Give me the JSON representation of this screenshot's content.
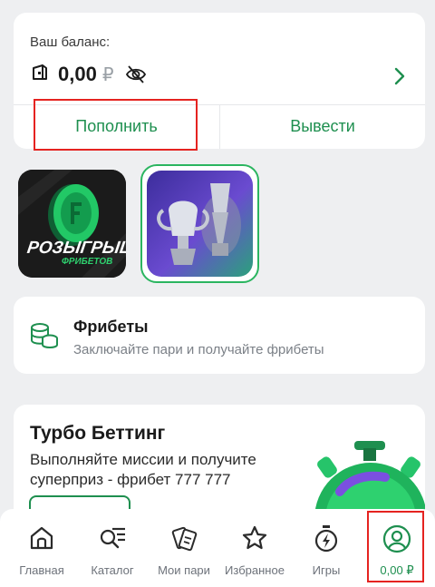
{
  "colors": {
    "accent": "#1e8f4f",
    "highlight": "#e52320",
    "background": "#eeeff1"
  },
  "balance": {
    "label": "Ваш баланс:",
    "amount": "0,00",
    "currency": "₽",
    "deposit_label": "Пополнить",
    "withdraw_label": "Вывести"
  },
  "stories": [
    {
      "name": "freebet-giveaway",
      "title": "РОЗЫГРЫШ",
      "subtitle": "ФРИБЕТОВ"
    },
    {
      "name": "trophies"
    }
  ],
  "freebets": {
    "title": "Фрибеты",
    "subtitle": "Заключайте пари и получайте фрибеты"
  },
  "turbo": {
    "title": "Турбо Беттинг",
    "description": "Выполняйте миссии и получите суперприз - фрибет 777 777"
  },
  "nav": [
    {
      "id": "home",
      "label": "Главная",
      "icon": "home-icon"
    },
    {
      "id": "catalog",
      "label": "Каталог",
      "icon": "catalog-search-icon"
    },
    {
      "id": "my-bets",
      "label": "Мои пари",
      "icon": "tickets-icon"
    },
    {
      "id": "favorites",
      "label": "Избранное",
      "icon": "star-icon"
    },
    {
      "id": "games",
      "label": "Игры",
      "icon": "stopwatch-icon"
    },
    {
      "id": "profile",
      "label": "0,00 ₽",
      "icon": "user-icon"
    }
  ]
}
